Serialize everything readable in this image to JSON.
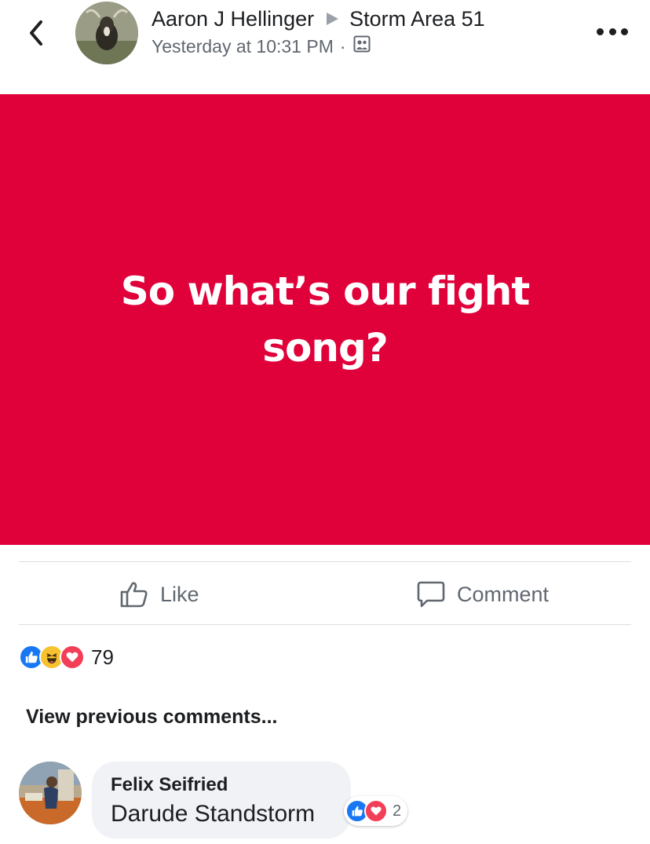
{
  "header": {
    "author": "Aaron J Hellinger",
    "group": "Storm Area 51",
    "timestamp": "Yesterday at 10:31 PM",
    "separator": "·",
    "audience_icon": "group-audience-icon"
  },
  "post": {
    "text": "So what’s our fight song?",
    "background_color": "#e0003a"
  },
  "actions": {
    "like_label": "Like",
    "comment_label": "Comment"
  },
  "reactions": {
    "types": [
      "like",
      "haha",
      "love"
    ],
    "count": "79"
  },
  "view_previous_label": "View previous comments...",
  "comment": {
    "author": "Felix Seifried",
    "text": "Darude Standstorm",
    "reaction_types": [
      "like",
      "love"
    ],
    "reaction_count": "2"
  }
}
